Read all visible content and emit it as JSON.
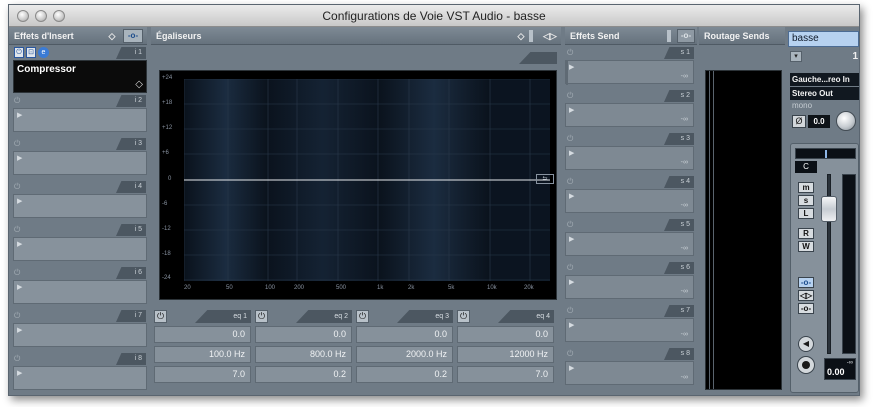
{
  "window": {
    "title": "Configurations de Voie VST Audio - basse"
  },
  "inserts": {
    "title": "Effets d'Insert",
    "slot1_plugin": "Compressor",
    "slots": [
      "i 1",
      "i 2",
      "i 3",
      "i 4",
      "i 5",
      "i 6",
      "i 7",
      "i 8"
    ]
  },
  "eq": {
    "title": "Égaliseurs",
    "y_ticks": [
      "+24",
      "+18",
      "+12",
      "+6",
      "0",
      "-6",
      "-12",
      "-18",
      "-24"
    ],
    "x_ticks": [
      "20",
      "50",
      "100",
      "200",
      "500",
      "1k",
      "2k",
      "5k",
      "10k",
      "20k"
    ],
    "bands": [
      {
        "label": "eq 1",
        "gain": "0.0",
        "freq": "100.0 Hz",
        "q": "7.0"
      },
      {
        "label": "eq 2",
        "gain": "0.0",
        "freq": "800.0 Hz",
        "q": "0.2"
      },
      {
        "label": "eq 3",
        "gain": "0.0",
        "freq": "2000.0 Hz",
        "q": "0.2"
      },
      {
        "label": "eq 4",
        "gain": "0.0",
        "freq": "12000 Hz",
        "q": "7.0"
      }
    ]
  },
  "sends": {
    "title": "Effets Send",
    "slots": [
      "s 1",
      "s 2",
      "s 3",
      "s 4",
      "s 5",
      "s 6",
      "s 7",
      "s 8"
    ],
    "inf": "-∞"
  },
  "routing": {
    "title": "Routage Sends"
  },
  "channel": {
    "name": "basse",
    "number": "1",
    "input": "Gauche...reo In",
    "output": "Stereo Out",
    "mono_label": "mono",
    "phase_value": "0.0",
    "pan_value": "C",
    "volume_value": "0.00",
    "peak": "-∞",
    "buttons": {
      "mute": "m",
      "solo": "s",
      "listen": "L",
      "read": "R",
      "write": "W"
    }
  }
}
